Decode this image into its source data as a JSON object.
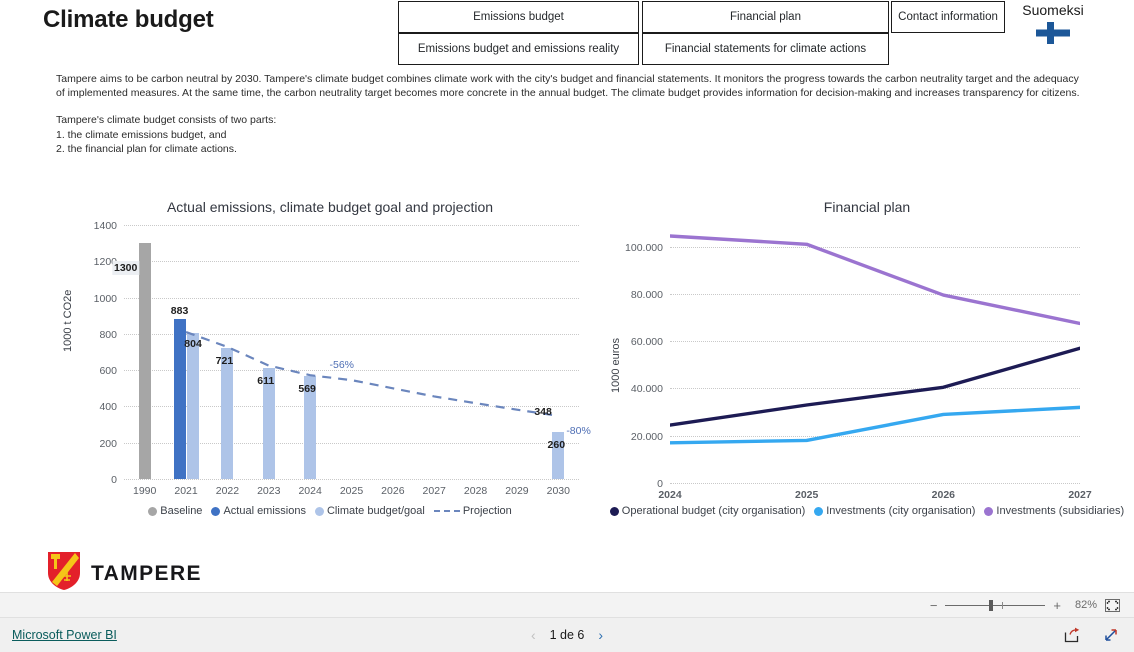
{
  "header": {
    "title": "Climate budget",
    "nav": [
      {
        "id": "emissions-budget",
        "label": "Emissions budget"
      },
      {
        "id": "financial-plan",
        "label": "Financial plan"
      },
      {
        "id": "contact-information",
        "label": "Contact information"
      },
      {
        "id": "emissions-reality",
        "label": "Emissions budget and emissions reality"
      },
      {
        "id": "financial-statements",
        "label": "Financial statements for climate actions"
      }
    ],
    "language_switch": {
      "label": "Suomeksi",
      "flag_icon": "finland-flag-icon"
    }
  },
  "intro": {
    "paragraph1": "Tampere aims to be carbon neutral by 2030. Tampere's climate budget combines climate work with the city's budget and financial statements. It monitors the progress towards the carbon neutrality target and the adequacy of implemented measures. At the same time, the carbon neutrality target becomes more concrete in the annual budget. The climate budget provides information for decision-making and increases transparency for citizens.",
    "paragraph2_line1": "Tampere's climate budget consists of two parts:",
    "paragraph2_line2": "1. the climate emissions budget, and",
    "paragraph2_line3": "2. the financial plan for climate actions."
  },
  "branding": {
    "city_name": "TAMPERE",
    "logo_icon": "tampere-coat-of-arms-icon"
  },
  "powerbi": {
    "zoom": {
      "minus_label": "−",
      "plus_label": "+",
      "percent": "82%",
      "fit_icon": "fit-to-page-icon"
    },
    "footer": {
      "brand_link": "Microsoft Power BI",
      "page_indicator": "1 de 6",
      "prev_icon": "chevron-left-icon",
      "next_icon": "chevron-right-icon",
      "share_icon": "share-icon",
      "fullscreen_icon": "fullscreen-icon"
    }
  },
  "chart_data": [
    {
      "type": "bar",
      "id": "emissions-chart",
      "title": "Actual emissions, climate budget goal and projection",
      "xlabel": "",
      "ylabel": "1000 t CO2e",
      "ylim": [
        0,
        1400
      ],
      "yticks": [
        0,
        200,
        400,
        600,
        800,
        1000,
        1200,
        1400
      ],
      "ytick_labels": [
        "0",
        "200",
        "400",
        "600",
        "800",
        "1000",
        "1200",
        "1400"
      ],
      "grid": true,
      "legend_position": "bottom",
      "categories": [
        "1990",
        "2021",
        "2022",
        "2023",
        "2024",
        "2025",
        "2026",
        "2027",
        "2028",
        "2029",
        "2030"
      ],
      "series": [
        {
          "name": "Baseline",
          "color": "#a6a6a6",
          "kind": "bar",
          "values": [
            1300,
            null,
            null,
            null,
            null,
            null,
            null,
            null,
            null,
            null,
            null
          ],
          "labels": [
            "1300",
            "",
            "",
            "",
            "",
            "",
            "",
            "",
            "",
            "",
            ""
          ]
        },
        {
          "name": "Actual emissions",
          "color": "#3f72c4",
          "kind": "bar",
          "values": [
            null,
            883,
            null,
            null,
            null,
            null,
            null,
            null,
            null,
            null,
            null
          ],
          "labels": [
            "",
            "883",
            "",
            "",
            "",
            "",
            "",
            "",
            "",
            "",
            ""
          ]
        },
        {
          "name": "Climate budget/goal",
          "color": "#aec4e8",
          "kind": "bar",
          "values": [
            null,
            804,
            721,
            611,
            569,
            null,
            null,
            null,
            null,
            null,
            260
          ],
          "labels": [
            "",
            "804",
            "721",
            "611",
            "569",
            "",
            "",
            "",
            "",
            "",
            "260"
          ]
        },
        {
          "name": "Projection",
          "color": "#6b86bd",
          "kind": "dashed-line",
          "values": [
            null,
            810,
            728,
            625,
            572,
            545,
            500,
            455,
            418,
            382,
            348
          ],
          "labels": [
            "",
            "",
            "",
            "",
            "",
            "",
            "",
            "",
            "",
            "",
            "348"
          ]
        }
      ],
      "annotations": [
        {
          "text": "-56%",
          "x_category": "2025",
          "y_value": 660,
          "color": "#4f6fb5"
        },
        {
          "text": "-80%",
          "x_category": "2030",
          "y_value": 295,
          "color": "#4f6fb5"
        },
        {
          "text": "348",
          "x_category": "2030",
          "y_value": 400,
          "color": "#1d1d1d"
        }
      ]
    },
    {
      "type": "line",
      "id": "financial-plan-chart",
      "title": "Financial plan",
      "xlabel": "",
      "ylabel": "1000 euros",
      "ylim": [
        0,
        110000
      ],
      "yticks": [
        0,
        20000,
        40000,
        60000,
        80000,
        100000
      ],
      "ytick_labels": [
        "0",
        "20.000",
        "40.000",
        "60.000",
        "80.000",
        "100.000"
      ],
      "grid": true,
      "legend_position": "bottom",
      "categories": [
        "2024",
        "2025",
        "2026",
        "2027"
      ],
      "x": [
        2024,
        2025,
        2026,
        2027
      ],
      "series": [
        {
          "name": "Operational budget (city organisation)",
          "color": "#1d1b54",
          "values": [
            24500,
            33000,
            40500,
            57000
          ]
        },
        {
          "name": "Investments (city organisation)",
          "color": "#35a8f0",
          "values": [
            17000,
            18000,
            29000,
            32000
          ]
        },
        {
          "name": "Investments (subsidiaries)",
          "color": "#9b74d0",
          "values": [
            104500,
            101000,
            79500,
            67500
          ]
        }
      ]
    }
  ]
}
